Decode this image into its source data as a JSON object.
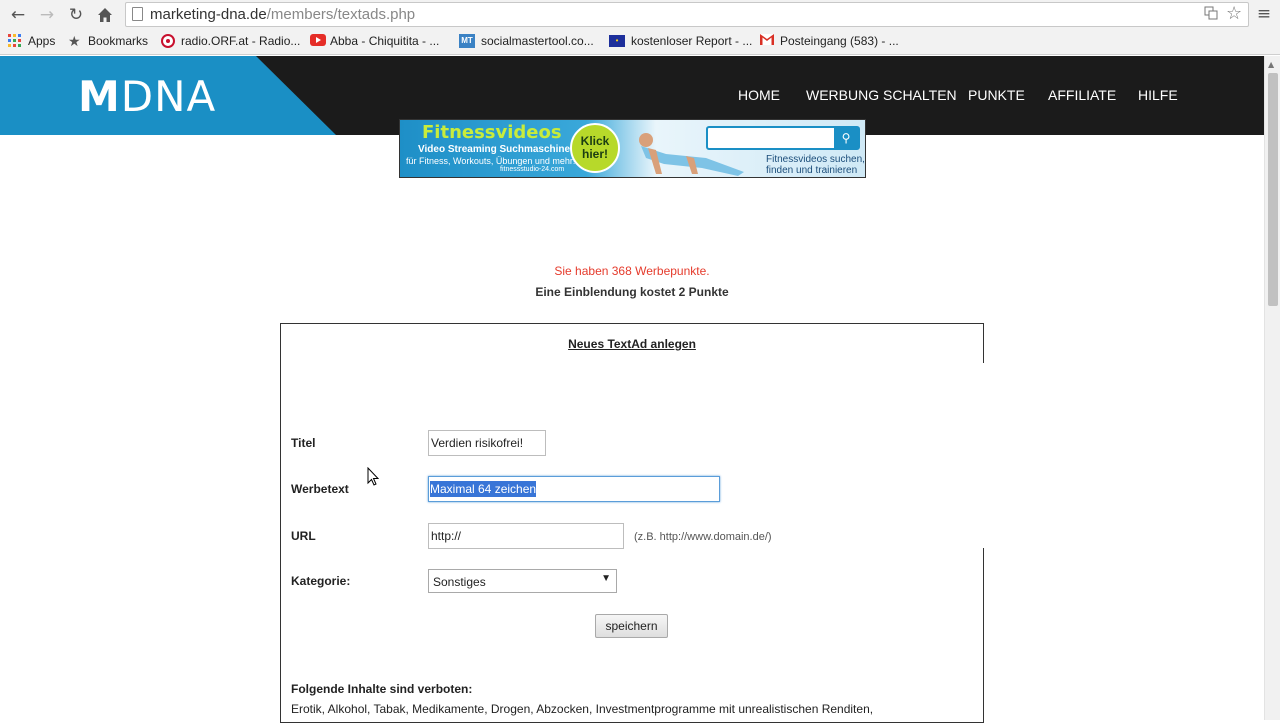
{
  "browser": {
    "url_host": "marketing-dna.de",
    "url_path": "/members/textads.php",
    "bookmarks": [
      {
        "label": "Apps",
        "icon": "apps-grid-icon"
      },
      {
        "label": "Bookmarks",
        "icon": "star-icon"
      },
      {
        "label": "radio.ORF.at - Radio...",
        "icon": "orf-icon"
      },
      {
        "label": "Abba - Chiquitita - ...",
        "icon": "youtube-icon"
      },
      {
        "label": "socialmastertool.co...",
        "icon": "mt-icon"
      },
      {
        "label": "kostenloser Report - ...",
        "icon": "eu-flag-icon"
      },
      {
        "label": "Posteingang (583) - ...",
        "icon": "gmail-icon"
      }
    ]
  },
  "site": {
    "logo_bold": "M",
    "logo_rest": "DNA",
    "nav": [
      "HOME",
      "WERBUNG SCHALTEN",
      "PUNKTE",
      "AFFILIATE",
      "HILFE"
    ]
  },
  "banner": {
    "title": "Fitnessvideos",
    "sub1": "Video Streaming Suchmaschine",
    "sub2": "für Fitness, Workouts, Übungen und mehr!",
    "sub3": "fitnessstudio-24.com",
    "cta": "Klick hier!",
    "right_line1": "Fitnessvideos suchen,",
    "right_line2": "finden und trainieren"
  },
  "points_message": "Sie haben 368 Werbepunkte.",
  "cost_message": "Eine Einblendung kostet 2 Punkte",
  "form": {
    "title": "Neues TextAd anlegen",
    "titel_label": "Titel",
    "titel_value": "Verdien risikofrei!",
    "werbetext_label": "Werbetext",
    "werbetext_value": "Maximal 64 zeichen",
    "url_label": "URL",
    "url_value": "http://",
    "url_hint": "(z.B. http://www.domain.de/)",
    "kategorie_label": "Kategorie:",
    "kategorie_value": "Sonstiges",
    "save_label": "speichern",
    "forbidden_title": "Folgende Inhalte sind verboten:",
    "forbidden_text": "Erotik, Alkohol, Tabak, Medikamente, Drogen, Abzocken, Investmentprogramme mit unrealistischen Renditen,"
  },
  "colors": {
    "brand_blue": "#1a8fc5",
    "header_dark": "#1b1b1b",
    "points_red": "#e53b2c"
  }
}
